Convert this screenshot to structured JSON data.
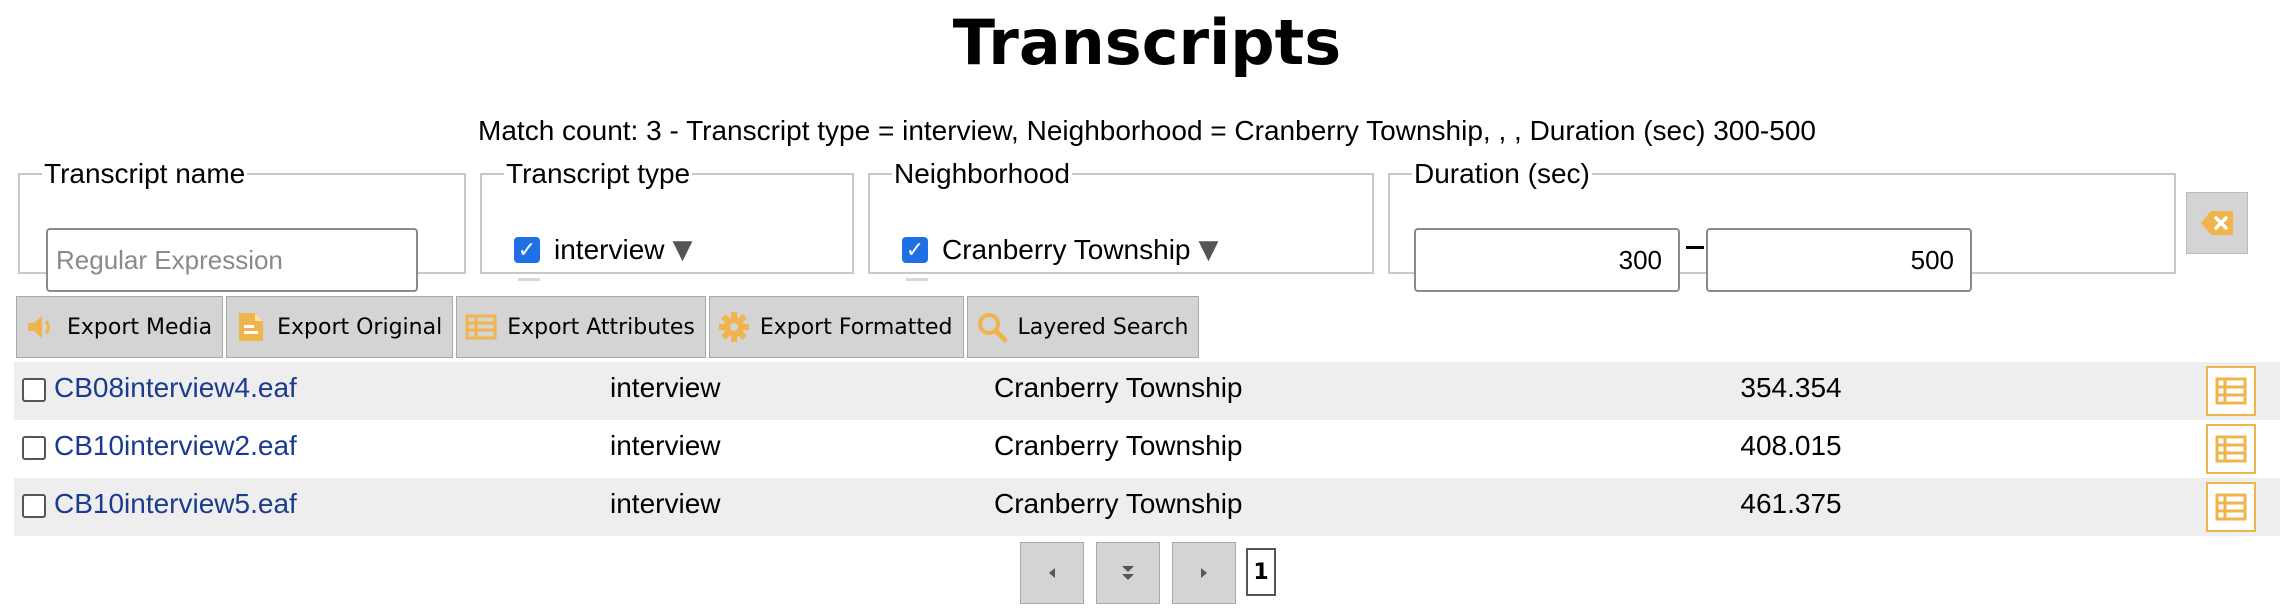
{
  "page": {
    "title": "Transcripts"
  },
  "match": {
    "summary": "Match count: 3 - Transcript type = interview, Neighborhood = Cranberry Township, , , Duration (sec) 300-500"
  },
  "filters": {
    "name": {
      "legend": "Transcript name",
      "placeholder": "Regular Expression",
      "value": ""
    },
    "type": {
      "legend": "Transcript type",
      "selected": "interview"
    },
    "neighborhood": {
      "legend": "Neighborhood",
      "selected": "Cranberry Township"
    },
    "duration": {
      "legend": "Duration (sec)",
      "from": "300",
      "to": "500"
    }
  },
  "toolbar": {
    "export_media": "Export Media",
    "export_original": "Export Original",
    "export_attributes": "Export Attributes",
    "export_formatted": "Export Formatted",
    "layered_search": "Layered Search"
  },
  "rows": [
    {
      "name": "CB08interview4.eaf",
      "type": "interview",
      "neighborhood": "Cranberry Township",
      "duration": "354.354"
    },
    {
      "name": "CB10interview2.eaf",
      "type": "interview",
      "neighborhood": "Cranberry Township",
      "duration": "408.015"
    },
    {
      "name": "CB10interview5.eaf",
      "type": "interview",
      "neighborhood": "Cranberry Township",
      "duration": "461.375"
    }
  ],
  "pager": {
    "page": "1"
  },
  "colors": {
    "accent_orange": "#f0b44c",
    "checkbox_blue": "#1f6fe6",
    "link_blue": "#1a3b8f",
    "button_gray": "#d4d4d4"
  },
  "icons": [
    "speaker-icon",
    "document-icon",
    "table-icon",
    "gear-icon",
    "magnifier-icon",
    "clear-icon",
    "attributes-icon",
    "prev-icon",
    "all-icon",
    "next-icon"
  ]
}
